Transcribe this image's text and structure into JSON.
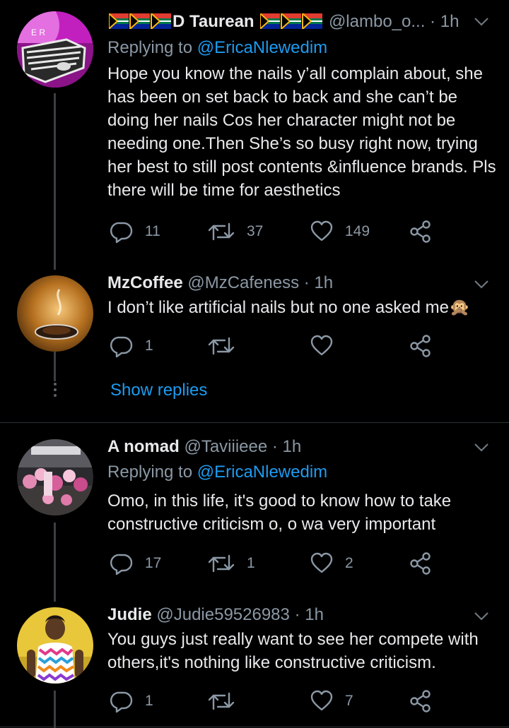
{
  "tweets": [
    {
      "name": "D Taurean",
      "handle": "@lambo_o...",
      "time": "1h",
      "replying_label": "Replying to",
      "replying_to": "@EricaNlewedim",
      "text": "Hope you know the nails y’all complain about, she has been on set back to back and she can’t be doing her nails Cos her character might not be needing one.Then She’s so busy right now, trying her best to still post contents &influence brands. Pls there will be time for aesthetics",
      "replies": "11",
      "retweets": "37",
      "likes": "149",
      "avatar_icon": "pink-car-avatar",
      "flag_icon": "south-africa-flag-icon"
    },
    {
      "name": "MzCoffee",
      "handle": "@MzCafeness",
      "time": "1h",
      "text": "I don’t like artificial nails but no one asked me",
      "emoji": "🙊",
      "replies": "1",
      "retweets": "",
      "likes": "",
      "avatar_icon": "coffee-cup-avatar"
    },
    {
      "name": "A nomad",
      "handle": "@Taviiieee",
      "time": "1h",
      "replying_label": "Replying to",
      "replying_to": "@EricaNlewedim",
      "text": "Omo, in this life, it's good to know how to take constructive criticism o, o wa very important",
      "replies": "17",
      "retweets": "1",
      "likes": "2",
      "avatar_icon": "balloons-avatar"
    },
    {
      "name": "Judie",
      "handle": "@Judie59526983",
      "time": "1h",
      "text": "You guys just really want to see her compete with others,it's nothing like constructive criticism.",
      "replies": "1",
      "retweets": "",
      "likes": "7",
      "avatar_icon": "woman-portrait-avatar"
    }
  ],
  "show_replies": "Show replies",
  "separator": "·",
  "colors": {
    "background": "#000000",
    "link": "#1d9bf0",
    "secondary_text": "#8b98a5",
    "primary_text": "#e7e9ea"
  }
}
